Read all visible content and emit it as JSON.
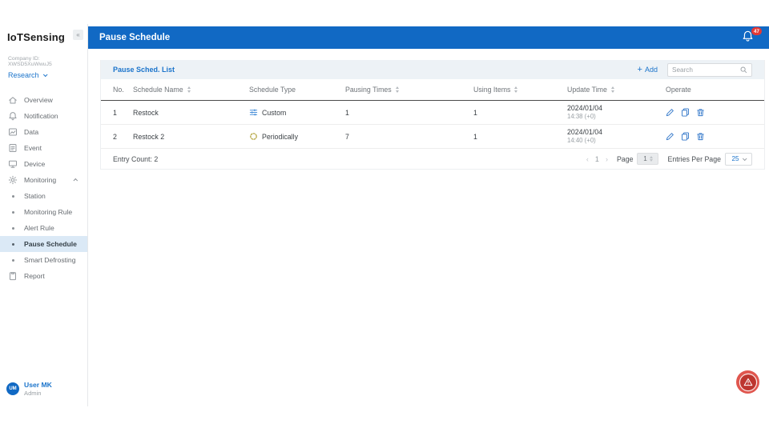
{
  "colors": {
    "brand_blue": "#1169c4",
    "link_blue": "#1b74cb",
    "badge_red": "#e53935",
    "alarm_outer_red": "#e0564e",
    "alarm_inner_red": "#bd362f",
    "custom_type_icon_blue": "#4a90d9",
    "periodic_type_icon_olive": "#b3a43e",
    "active_item_bg": "#dbe9f6",
    "card_head_bg": "#edf2f6"
  },
  "app": {
    "logo": "IoTSensing",
    "collapse_glyph": "«"
  },
  "sidebar": {
    "company_id": "Company ID: XWSD5XuWwuJ5",
    "workspace": "Research",
    "items": [
      {
        "label": "Overview",
        "icon": "home-icon"
      },
      {
        "label": "Notification",
        "icon": "bell-icon"
      },
      {
        "label": "Data",
        "icon": "chart-icon"
      },
      {
        "label": "Event",
        "icon": "event-icon"
      },
      {
        "label": "Device",
        "icon": "device-icon"
      },
      {
        "label": "Monitoring",
        "icon": "gear-icon"
      }
    ],
    "monitoring_children": [
      {
        "label": "Station"
      },
      {
        "label": "Monitoring Rule"
      },
      {
        "label": "Alert Rule"
      },
      {
        "label": "Pause Schedule"
      },
      {
        "label": "Smart Defrosting"
      }
    ],
    "report": {
      "label": "Report",
      "icon": "report-icon"
    },
    "user": {
      "initials": "UM",
      "name": "User MK",
      "role": "Admin"
    }
  },
  "header": {
    "title": "Pause Schedule",
    "notification_count": "47"
  },
  "panel": {
    "title": "Pause Sched. List",
    "add_glyph": "+",
    "add_label": "Add",
    "search_placeholder": "Search"
  },
  "table": {
    "columns": [
      {
        "label": "No.",
        "sortable": false
      },
      {
        "label": "Schedule Name",
        "sortable": true
      },
      {
        "label": "Schedule Type",
        "sortable": false
      },
      {
        "label": "Pausing Times",
        "sortable": true
      },
      {
        "label": "Using Items",
        "sortable": true
      },
      {
        "label": "Update Time",
        "sortable": true
      },
      {
        "label": "Operate",
        "sortable": false
      }
    ],
    "rows": [
      {
        "no": "1",
        "name": "Restock",
        "type": "Custom",
        "type_icon": "sliders-icon",
        "pausing_times": "1",
        "using_items": "1",
        "update_date": "2024/01/04",
        "update_time": "14:38 (+0)"
      },
      {
        "no": "2",
        "name": "Restock 2",
        "type": "Periodically",
        "type_icon": "cycle-icon",
        "pausing_times": "7",
        "using_items": "1",
        "update_date": "2024/01/04",
        "update_time": "14:40 (+0)"
      }
    ]
  },
  "footer": {
    "entry_count": "Entry Count: 2",
    "prev_glyph": "‹",
    "current_page": "1",
    "next_glyph": "›",
    "page_label": "Page",
    "page_value": "1",
    "entries_label": "Entries Per Page",
    "entries_value": "25"
  }
}
